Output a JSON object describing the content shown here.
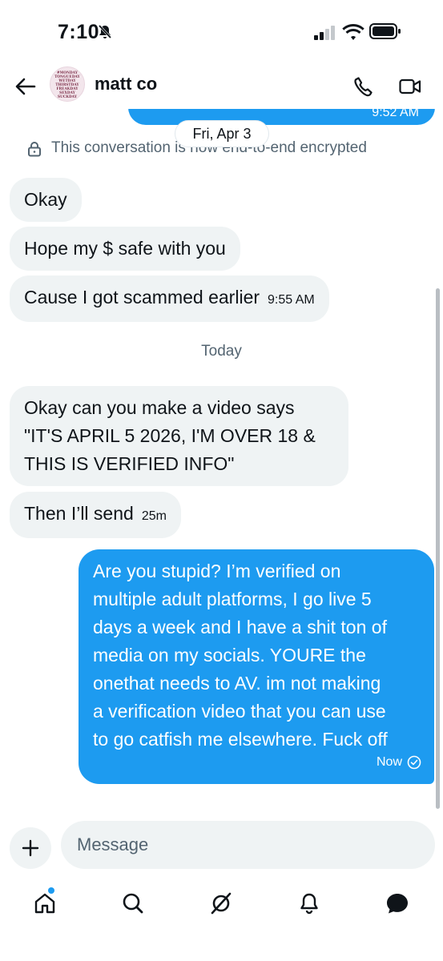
{
  "status_bar": {
    "time": "7:10"
  },
  "header": {
    "contact_name": "matt co",
    "avatar_text": [
      "#MONDAY",
      "TONGUEDAY",
      "WETDAY",
      "THIRSTDAY",
      "FREAKDAY",
      "SEXDAY",
      "SUCKDAY"
    ]
  },
  "chat": {
    "previous_message_time": "9:52 AM",
    "date_separator": "Fri, Apr 3",
    "encryption_notice": "This conversation is now end-to-end encrypted",
    "day_label": "Today",
    "incoming": [
      {
        "text": "Okay",
        "time": ""
      },
      {
        "text": "Hope my $ safe with you",
        "time": ""
      },
      {
        "text": "Cause I got scammed earlier",
        "time": "9:55 AM"
      },
      {
        "text_lines": [
          "Okay can you make a video says",
          "\"IT'S APRIL 5 2026, I'M OVER 18 &",
          "THIS IS VERIFIED INFO\""
        ],
        "time": ""
      },
      {
        "text": "Then I’ll send",
        "time": "25m"
      }
    ],
    "outgoing": {
      "text_lines": [
        "Are you stupid? I’m verified on",
        "multiple adult platforms, I go live 5",
        "days a week and I have a shit ton of",
        "media on my socials. YOURE the",
        "onethat needs to AV. im not making",
        "a verification video that you can use",
        "to go catfish me elsewhere. Fuck off"
      ],
      "time": "Now"
    }
  },
  "composer": {
    "placeholder": "Message"
  },
  "colors": {
    "accent": "#1d9bf0",
    "incoming_bubble": "#eff3f4",
    "muted_text": "#536471"
  },
  "nav": {
    "icons": [
      "home-icon",
      "search-icon",
      "grok-icon",
      "notifications-icon",
      "messages-icon"
    ]
  }
}
